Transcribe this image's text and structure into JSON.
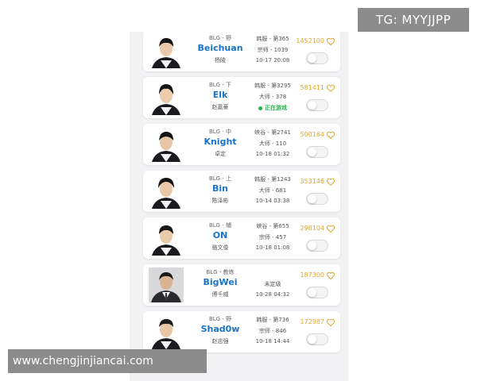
{
  "players": [
    {
      "team_role": "BLG - 野",
      "name": "Beichuan",
      "real_name": "杨陵",
      "server_rank": "韩服 - 第365",
      "tier": "宗师 - 1039",
      "time": "10-17 20:08",
      "score": "1452100",
      "avatar": "player-avatar"
    },
    {
      "team_role": "BLG - 下",
      "name": "Elk",
      "real_name": "赵嘉豪",
      "server_rank": "韩服 - 第3295",
      "tier": "大师 - 378",
      "status": "正在游戏",
      "score": "581411",
      "avatar": "player-avatar"
    },
    {
      "team_role": "BLG - 中",
      "name": "Knight",
      "real_name": "卓定",
      "server_rank": "峡谷 - 第2741",
      "tier": "大师 - 110",
      "time": "10-18 01:32",
      "score": "500164",
      "avatar": "player-avatar"
    },
    {
      "team_role": "BLG - 上",
      "name": "Bin",
      "real_name": "陈泽彬",
      "server_rank": "韩服 - 第1243",
      "tier": "大师 - 681",
      "time": "10-14 03:38",
      "score": "353146",
      "avatar": "player-avatar"
    },
    {
      "team_role": "BLG - 辅",
      "name": "ON",
      "real_name": "骆文俊",
      "server_rank": "峡谷 - 第655",
      "tier": "宗师 - 457",
      "time": "10-18 01:08",
      "score": "298104",
      "avatar": "player-avatar"
    },
    {
      "team_role": "BLG - 教练",
      "name": "BigWei",
      "real_name": "傅千威",
      "server_rank": "",
      "tier": "未定级",
      "time": "10-28 04:32",
      "score": "187300",
      "avatar": "coach-avatar"
    },
    {
      "team_role": "BLG - 野",
      "name": "Shad0w",
      "real_name": "赵志强",
      "server_rank": "韩服 - 第736",
      "tier": "宗师 - 846",
      "time": "10-18 14:44",
      "score": "172987",
      "avatar": "player-avatar"
    }
  ],
  "watermark_tg": "TG: MYYJJPP",
  "watermark_site": "www.chengjinjiancai.com",
  "colors": {
    "name": "#1a73c8",
    "score": "#e0a82e",
    "status": "#2bb24c"
  }
}
